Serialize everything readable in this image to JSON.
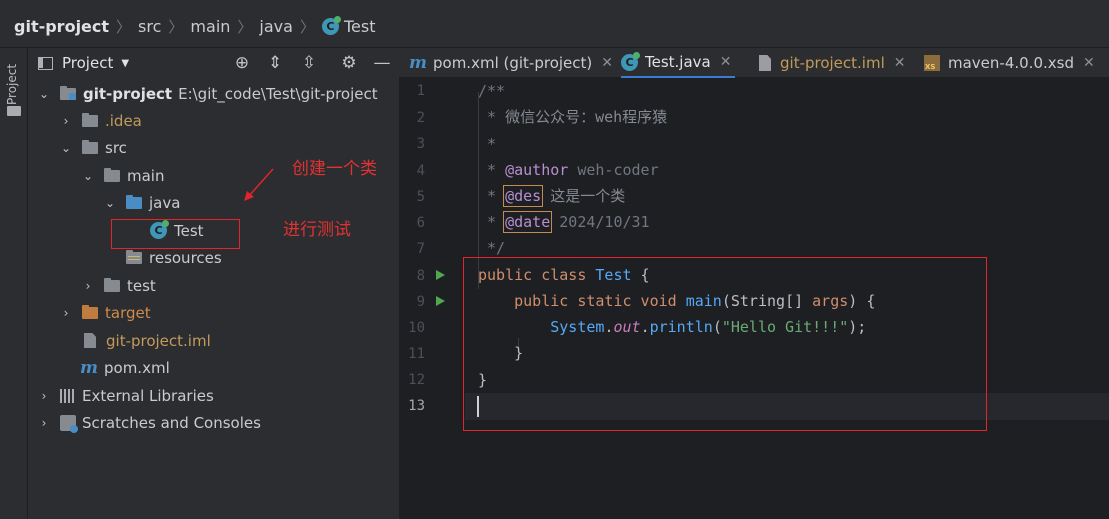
{
  "breadcrumb": {
    "items": [
      "git-project",
      "src",
      "main",
      "java",
      "Test"
    ]
  },
  "left_stripe": {
    "project_label": "Project"
  },
  "project_panel": {
    "title": "Project",
    "toolbar_icons": [
      "locate-icon",
      "expand-all-icon",
      "collapse-all-icon",
      "gear-icon",
      "minimize-icon"
    ],
    "tree": [
      {
        "label": "git-project",
        "path": "E:\\git_code\\Test\\git-project"
      },
      {
        "label": ".idea"
      },
      {
        "label": "src"
      },
      {
        "label": "main"
      },
      {
        "label": "java"
      },
      {
        "label": "Test"
      },
      {
        "label": "resources"
      },
      {
        "label": "test"
      },
      {
        "label": "target"
      },
      {
        "label": "git-project.iml"
      },
      {
        "label": "pom.xml"
      },
      {
        "label": "External Libraries"
      },
      {
        "label": "Scratches and Consoles"
      }
    ]
  },
  "annotations": {
    "create_class": "创建一个类",
    "do_test": "进行测试"
  },
  "editor": {
    "tabs": [
      {
        "label": "pom.xml (git-project)",
        "icon": "maven-icon"
      },
      {
        "label": "Test.java",
        "icon": "java-class-icon",
        "active": true
      },
      {
        "label": "git-project.iml",
        "icon": "iml-file-icon"
      },
      {
        "label": "maven-4.0.0.xsd",
        "icon": "xsd-file-icon"
      }
    ],
    "line_numbers": [
      "1",
      "2",
      "3",
      "4",
      "5",
      "6",
      "7",
      "8",
      "9",
      "10",
      "11",
      "12",
      "13"
    ],
    "code": {
      "l1": "/**",
      "l2_star": " * ",
      "l2_text": "微信公众号：weh程序猿",
      "l3": " *",
      "l4_star": " * ",
      "l4_tag": "@author",
      "l4_text": " weh-coder",
      "l5_star": " * ",
      "l5_tag": "@des",
      "l5_text": " 这是一个类",
      "l6_star": " * ",
      "l6_tag": "@date",
      "l6_text": " 2024/10/31",
      "l7": " */",
      "l8_kw": "public class ",
      "l8_cls": "Test",
      "l8_rest": " {",
      "l9_kw": "    public static void ",
      "l9_fn": "main",
      "l9_p1": "(",
      "l9_type": "String",
      "l9_p2": "[] ",
      "l9_param": "args",
      "l9_p3": ") {",
      "l10_ind": "        ",
      "l10_cls": "System",
      "l10_dot": ".",
      "l10_fld": "out",
      "l10_dot2": ".",
      "l10_fn": "println",
      "l10_p1": "(",
      "l10_str": "\"Hello Git!!!\"",
      "l10_p2": ");",
      "l11": "    }",
      "l12": "}"
    }
  },
  "colors": {
    "annotation_red": "#e0262a",
    "keyword": "#cf8e6d",
    "string": "#6aab73",
    "class_name": "#56a8f5",
    "active_tab_underline": "#3b7cd1"
  }
}
